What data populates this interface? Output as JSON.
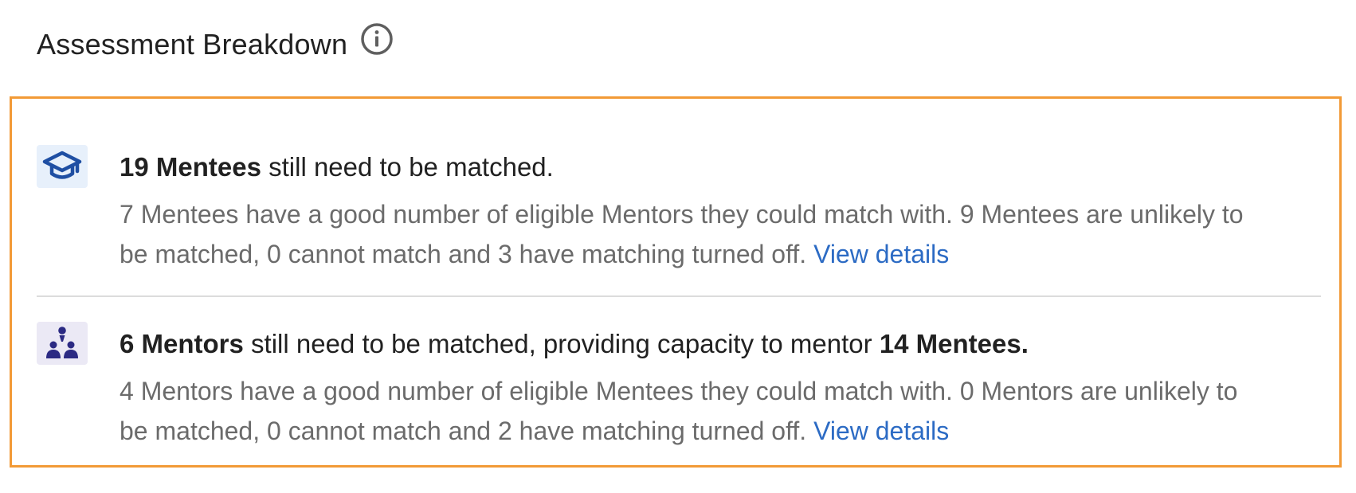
{
  "header": {
    "title": "Assessment Breakdown",
    "info_icon": "info-circle-icon"
  },
  "colors": {
    "panel_border": "#f29a36",
    "link": "#2c6bc4",
    "mentee_icon": "#1f4fa3",
    "mentor_icon": "#2b2a83"
  },
  "mentees": {
    "icon": "graduation-cap-icon",
    "count_label": "19 Mentees",
    "headline_rest": " still need to be matched.",
    "detail": "7 Mentees have a good number of eligible Mentors they could match with. 9 Mentees are unlikely to be matched, 0 cannot match and 3 have matching turned off. ",
    "link_label": "View details"
  },
  "mentors": {
    "icon": "mentor-group-icon",
    "count_label": "6 Mentors",
    "headline_mid": " still need to be matched, providing capacity to mentor ",
    "capacity_label": "14 Mentees.",
    "detail": "4 Mentors have a good number of eligible Mentees they could match with. 0 Mentors are unlikely to be matched, 0 cannot match and 2 have matching turned off. ",
    "link_label": "View details"
  }
}
